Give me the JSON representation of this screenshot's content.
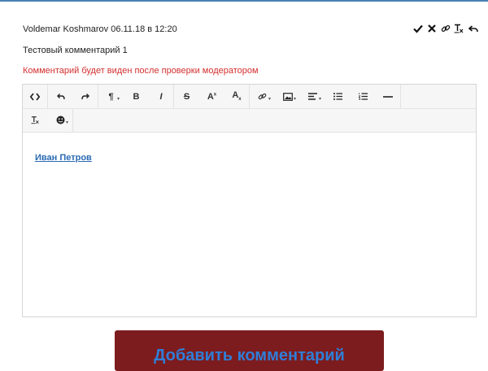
{
  "comment": {
    "author_line": "Voldemar Koshmarov 06.11.18 в 12:20",
    "text": "Тестовый комментарий 1",
    "moderation_notice": "Комментарий будет виден после проверки модератором"
  },
  "actions": {
    "icons": [
      "check-icon",
      "close-icon",
      "link-icon",
      "clear-format-icon",
      "reply-icon"
    ]
  },
  "toolbar": {
    "row1": [
      {
        "name": "code-view-button",
        "icon": "code-icon"
      },
      {
        "name": "undo-button",
        "icon": "undo-icon"
      },
      {
        "name": "redo-button",
        "icon": "redo-icon"
      },
      {
        "name": "paragraph-format-button",
        "icon": "pilcrow-icon",
        "label": "¶"
      },
      {
        "name": "bold-button",
        "icon": "bold-icon",
        "label": "B"
      },
      {
        "name": "italic-button",
        "icon": "italic-icon",
        "label": "I"
      },
      {
        "name": "strikethrough-button",
        "icon": "strikethrough-icon",
        "label": "S"
      },
      {
        "name": "superscript-button",
        "icon": "superscript-icon",
        "label": "A"
      },
      {
        "name": "subscript-button",
        "icon": "subscript-icon",
        "label": "A"
      },
      {
        "name": "insert-link-button",
        "icon": "link-icon"
      },
      {
        "name": "insert-image-button",
        "icon": "image-icon"
      },
      {
        "name": "align-button",
        "icon": "align-left-icon"
      },
      {
        "name": "unordered-list-button",
        "icon": "bullet-list-icon"
      },
      {
        "name": "ordered-list-button",
        "icon": "numbered-list-icon"
      },
      {
        "name": "horizontal-rule-button",
        "icon": "horizontal-rule-icon"
      }
    ],
    "row2": [
      {
        "name": "clear-format-button",
        "icon": "clear-format-icon"
      },
      {
        "name": "emoticons-button",
        "icon": "smiley-icon"
      }
    ]
  },
  "editor": {
    "mention": "Иван Петров"
  },
  "submit": {
    "label": "Добавить комментарий"
  }
}
